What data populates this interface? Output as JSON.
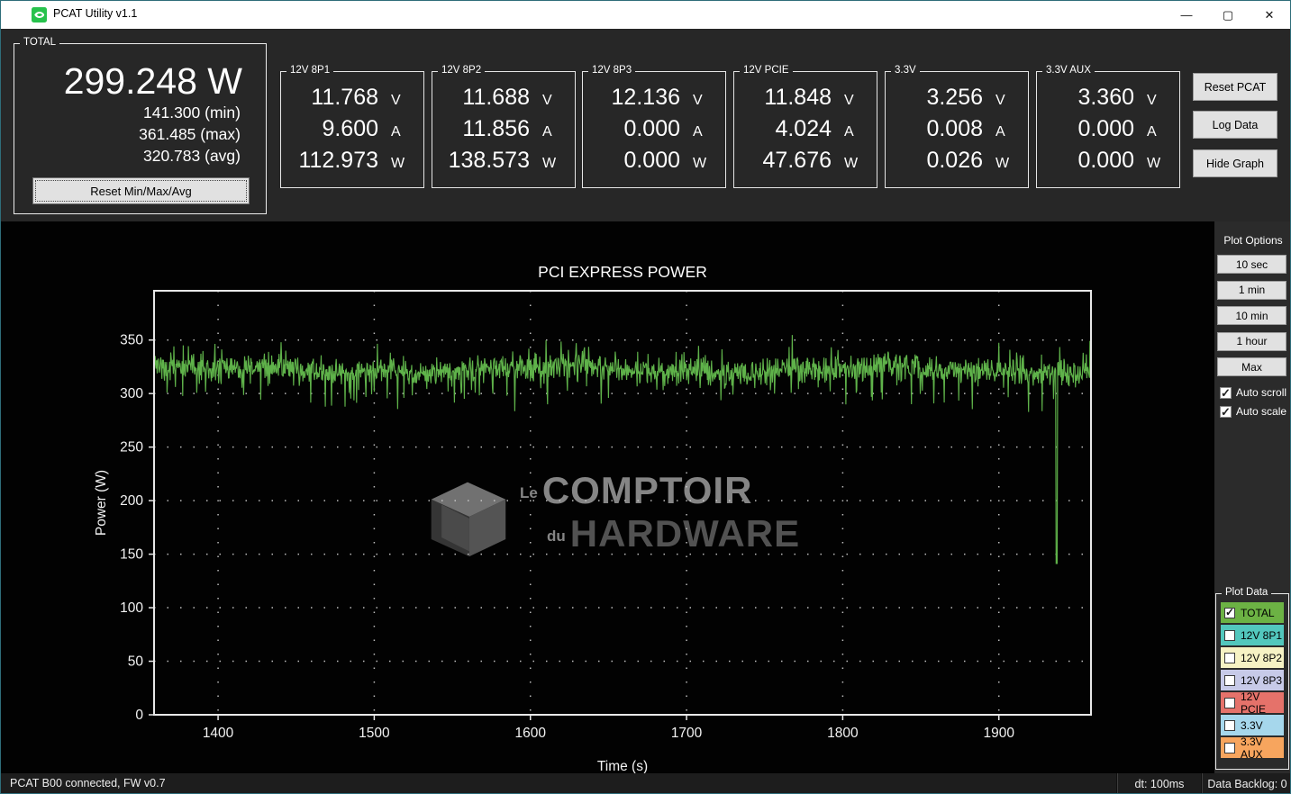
{
  "window": {
    "title": "PCAT Utility v1.1",
    "controls": {
      "minimize": "—",
      "maximize": "▢",
      "close": "✕"
    }
  },
  "total": {
    "label": "TOTAL",
    "value": "299.248 W",
    "min": "141.300 (min)",
    "max": "361.485 (max)",
    "avg": "320.783 (avg)",
    "reset_button": "Reset Min/Max/Avg"
  },
  "units": {
    "volts": "V",
    "amps": "A",
    "watts": "W"
  },
  "channels": [
    {
      "label": "12V 8P1",
      "volts": "11.768",
      "amps": "9.600",
      "watts": "112.973"
    },
    {
      "label": "12V 8P2",
      "volts": "11.688",
      "amps": "11.856",
      "watts": "138.573"
    },
    {
      "label": "12V 8P3",
      "volts": "12.136",
      "amps": "0.000",
      "watts": "0.000"
    },
    {
      "label": "12V PCIE",
      "volts": "11.848",
      "amps": "4.024",
      "watts": "47.676"
    },
    {
      "label": "3.3V",
      "volts": "3.256",
      "amps": "0.008",
      "watts": "0.026"
    },
    {
      "label": "3.3V AUX",
      "volts": "3.360",
      "amps": "0.000",
      "watts": "0.000"
    }
  ],
  "actions": {
    "reset_pcat": "Reset PCAT",
    "log_data": "Log Data",
    "hide_graph": "Hide Graph"
  },
  "plot_options": {
    "label": "Plot Options",
    "buttons": [
      "10 sec",
      "1 min",
      "10 min",
      "1 hour",
      "Max"
    ],
    "checkboxes": [
      {
        "label": "Auto scroll",
        "checked": true
      },
      {
        "label": "Auto scale",
        "checked": true
      }
    ]
  },
  "plot_data": {
    "label": "Plot Data",
    "items": [
      {
        "label": "TOTAL",
        "color": "#6cb244",
        "checked": true
      },
      {
        "label": "12V 8P1",
        "color": "#52c7bd",
        "checked": false
      },
      {
        "label": "12V 8P2",
        "color": "#f6f2c4",
        "checked": false
      },
      {
        "label": "12V 8P3",
        "color": "#c7cae8",
        "checked": false
      },
      {
        "label": "12V PCIE",
        "color": "#e5726a",
        "checked": false
      },
      {
        "label": "3.3V",
        "color": "#a6d7ec",
        "checked": false
      },
      {
        "label": "3.3V AUX",
        "color": "#f7a55e",
        "checked": false
      }
    ]
  },
  "watermark": {
    "small1": "Le",
    "line1": "COMPTOIR",
    "small2": "du",
    "line2": "HARDWARE"
  },
  "status_bar": {
    "left": "PCAT B00 connected, FW v0.7",
    "dt": "dt: 100ms",
    "backlog": "Data Backlog: 0"
  },
  "chart_data": {
    "type": "line",
    "title": "PCI EXPRESS POWER",
    "xlabel": "Time (s)",
    "ylabel": "Power (W)",
    "xlim": [
      1359,
      1959
    ],
    "ylim": [
      0,
      396
    ],
    "xticks": [
      1400,
      1500,
      1600,
      1700,
      1800,
      1900
    ],
    "yticks": [
      0,
      50,
      100,
      150,
      200,
      250,
      300,
      350
    ],
    "grid": true,
    "legend": "none",
    "series": [
      {
        "name": "TOTAL",
        "color": "#5fb24a",
        "baseline_w": 322,
        "band_w": [
          300,
          350
        ],
        "extremes_w": [
          278,
          361
        ],
        "min_spike": {
          "t": 1937,
          "value": 141.3
        },
        "last_value": 299.248,
        "points_per_second": 3,
        "seed": 20
      }
    ]
  }
}
